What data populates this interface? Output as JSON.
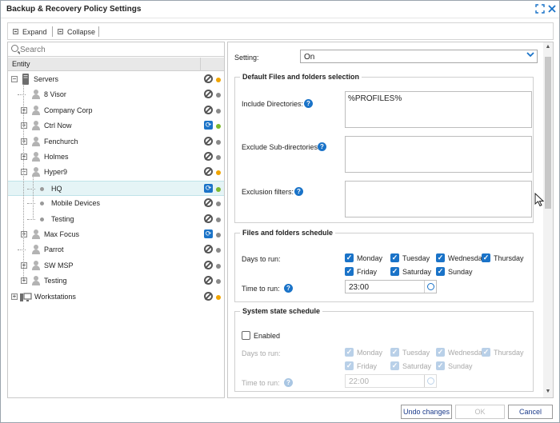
{
  "window": {
    "title": "Backup & Recovery Policy Settings"
  },
  "toolbar": {
    "expand_label": "Expand",
    "collapse_label": "Collapse"
  },
  "left_panel": {
    "search_placeholder": "Search",
    "column_header": "Entity",
    "tree": [
      {
        "label": "Servers",
        "icon": "server-icon",
        "status": "no-policy-icon",
        "indicator": "#f0a400"
      },
      {
        "label": "8 Visor",
        "icon": "user-icon",
        "status": "no-policy-icon",
        "indicator": "#8a8a8a"
      },
      {
        "label": "Company Corp",
        "icon": "user-icon",
        "status": "no-policy-icon",
        "indicator": "#8a8a8a"
      },
      {
        "label": "Ctrl Now",
        "icon": "user-icon",
        "status": "sync-icon",
        "indicator": "#7cb82f"
      },
      {
        "label": "Fenchurch",
        "icon": "user-icon",
        "status": "no-policy-icon",
        "indicator": "#8a8a8a"
      },
      {
        "label": "Holmes",
        "icon": "user-icon",
        "status": "no-policy-icon",
        "indicator": "#8a8a8a"
      },
      {
        "label": "Hyper9",
        "icon": "user-icon",
        "status": "no-policy-icon",
        "indicator": "#f0a400"
      },
      {
        "label": "HQ",
        "icon": "bullet",
        "status": "sync-icon",
        "indicator": "#7cb82f"
      },
      {
        "label": "Mobile Devices",
        "icon": "bullet",
        "status": "no-policy-icon",
        "indicator": "#8a8a8a"
      },
      {
        "label": "Testing",
        "icon": "bullet",
        "status": "no-policy-icon",
        "indicator": "#8a8a8a"
      },
      {
        "label": "Max Focus",
        "icon": "user-icon",
        "status": "sync-icon",
        "indicator": "#8a8a8a"
      },
      {
        "label": "Parrot",
        "icon": "user-icon",
        "status": "no-policy-icon",
        "indicator": "#8a8a8a"
      },
      {
        "label": "SW MSP",
        "icon": "user-icon",
        "status": "no-policy-icon",
        "indicator": "#8a8a8a"
      },
      {
        "label": "Testing",
        "icon": "user-icon",
        "status": "no-policy-icon",
        "indicator": "#8a8a8a"
      },
      {
        "label": "Workstations",
        "icon": "workstation-icon",
        "status": "no-policy-icon",
        "indicator": "#f0a400"
      }
    ]
  },
  "settings": {
    "setting_label": "Setting:",
    "setting_value": "On",
    "default_files": {
      "legend": "Default Files and folders selection",
      "include_label": "Include Directories:",
      "include_value": "%PROFILES%",
      "exclude_label": "Exclude Sub-directories:",
      "exclude_value": "",
      "filters_label": "Exclusion filters:",
      "filters_value": ""
    },
    "files_schedule": {
      "legend": "Files and folders schedule",
      "days_label": "Days to run:",
      "days": [
        "Monday",
        "Tuesday",
        "Wednesday",
        "Thursday",
        "Friday",
        "Saturday",
        "Sunday"
      ],
      "time_label": "Time to run:",
      "time_value": "23:00"
    },
    "system_schedule": {
      "legend": "System state schedule",
      "enabled_label": "Enabled",
      "days_label": "Days to run:",
      "days": [
        "Monday",
        "Tuesday",
        "Wednesday",
        "Thursday",
        "Friday",
        "Saturday",
        "Sunday"
      ],
      "time_label": "Time to run:",
      "time_value": "22:00"
    }
  },
  "footer": {
    "undo_label": "Undo changes",
    "ok_label": "OK",
    "cancel_label": "Cancel"
  },
  "colors": {
    "accent": "#1a73c8",
    "selected_row": "#e5f4f6",
    "orange": "#f0a400",
    "green": "#7cb82f"
  }
}
